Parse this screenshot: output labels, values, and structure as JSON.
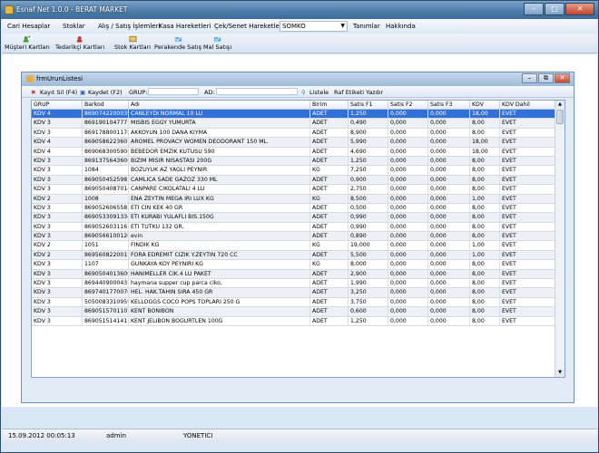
{
  "window": {
    "title": "Esnaf Net 1.0.0 - BERAT MARKET"
  },
  "menu": {
    "items": [
      "Cari Hesaplar",
      "Stoklar",
      "Alış / Satış İşlemleri",
      "Kasa Hareketleri",
      "Çek/Senet Hareketleri"
    ],
    "combo_value": "SOMKO",
    "right_items": [
      "Tanımlar",
      "Hakkında"
    ]
  },
  "toolbar": {
    "buttons": [
      "Müşteri Kartları",
      "Tedarikçi Kartları",
      "Stok Kartları",
      "Perakende Satış",
      "Mal Satışı"
    ]
  },
  "child": {
    "title": "frmUrunListesi",
    "toolbar": {
      "delete": "Kayıt Sil (F4)",
      "save": "Kaydet (F2)",
      "grup_label": "GRUP:",
      "ad_label": "AD:",
      "list": "Listele",
      "print": "Raf Etiketi Yazdır"
    }
  },
  "grid": {
    "headers": [
      "GRUP",
      "Barkod",
      "Adı",
      "Birim",
      "Satis F1",
      "Satis F2",
      "Satis F3",
      "KDV",
      "KDV Dahil"
    ],
    "rows": [
      [
        "KDV 4",
        "8690742200039",
        "CANLEYDI NORMAL 10 LU",
        "ADET",
        "1,250",
        "0,000",
        "0,000",
        "18,00",
        "EVET"
      ],
      [
        "KDV 3",
        "8691901047771",
        "MISBIS EGGY YUMURTA",
        "ADET",
        "0,490",
        "0,000",
        "0,000",
        "8,00",
        "EVET"
      ],
      [
        "KDV 3",
        "8691788001178",
        "AKKOYUN 100 DANA KIYMA",
        "ADET",
        "8,900",
        "0,000",
        "0,000",
        "8,00",
        "EVET"
      ],
      [
        "KDV 4",
        "8690586223607",
        "AROMEL PROVACY WOMEN DEODORANT 150 ML.",
        "ADET",
        "5,990",
        "0,000",
        "0,000",
        "18,00",
        "EVET"
      ],
      [
        "KDV 4",
        "8690683005908",
        "BEBEDOR EMZIK KUTUSU 590",
        "ADET",
        "4,690",
        "0,000",
        "0,000",
        "18,00",
        "EVET"
      ],
      [
        "KDV 3",
        "8691375643606",
        "BIZIM MISIR NISASTASI 200G",
        "ADET",
        "1,250",
        "0,000",
        "0,000",
        "8,00",
        "EVET"
      ],
      [
        "KDV 3",
        "1084",
        "BOZUYUK AZ YAGLI PEYNIR",
        "KG",
        "7,250",
        "0,000",
        "0,000",
        "8,00",
        "EVET"
      ],
      [
        "KDV 3",
        "8690504525981",
        "CAMLICA SADE GAZOZ 330 ML",
        "ADET",
        "0,900",
        "0,000",
        "0,000",
        "8,00",
        "EVET"
      ],
      [
        "KDV 3",
        "8690504087014",
        "CANPARE CIKOLATALI 4 LU",
        "ADET",
        "2,750",
        "0,000",
        "0,000",
        "8,00",
        "EVET"
      ],
      [
        "KDV 2",
        "1008",
        "ENA ZEYTIN MEGA IRI LUX KG",
        "KG",
        "8,500",
        "0,000",
        "0,000",
        "1,00",
        "EVET"
      ],
      [
        "KDV 3",
        "8690526065582",
        "ETI CIN KEK 40 GR",
        "ADET",
        "0,500",
        "0,000",
        "0,000",
        "8,00",
        "EVET"
      ],
      [
        "KDV 3",
        "8690533091334",
        "ETI KURABI  YULAFLI BIS.150G",
        "ADET",
        "0,990",
        "0,000",
        "0,000",
        "8,00",
        "EVET"
      ],
      [
        "KDV 3",
        "8690526031161",
        "ETI TUTKU 132 GR,",
        "ADET",
        "0,990",
        "0,000",
        "0,000",
        "8,00",
        "EVET"
      ],
      [
        "KDV 3",
        "8690566100126",
        "evin",
        "ADET",
        "0,890",
        "0,000",
        "0,000",
        "8,00",
        "EVET"
      ],
      [
        "KDV 2",
        "1051",
        "FINDIK KG",
        "KG",
        "19,000",
        "0,000",
        "0,000",
        "1,00",
        "EVET"
      ],
      [
        "KDV 2",
        "8695608220015",
        "FORA EDREMIT CIZIK Y.ZEYTIN 720 CC",
        "ADET",
        "5,500",
        "0,000",
        "0,000",
        "1,00",
        "EVET"
      ],
      [
        "KDV 3",
        "1107",
        "GUNKAYA KOY PEYNIRI KG",
        "KG",
        "8,000",
        "0,000",
        "0,000",
        "8,00",
        "EVET"
      ],
      [
        "KDV 3",
        "8690504013600",
        "HANIMELLER CIK.4 LU PAKET",
        "ADET",
        "2,900",
        "0,000",
        "0,000",
        "8,00",
        "EVET"
      ],
      [
        "KDV 3",
        "8694409000437",
        "haymana supper cup parca ciko,",
        "ADET",
        "1,990",
        "0,000",
        "0,000",
        "8,00",
        "EVET"
      ],
      [
        "KDV 3",
        "8697401770070",
        "HEL. HAK.TAHIN SIRA 450 GR",
        "ADET",
        "3,250",
        "0,000",
        "0,000",
        "8,00",
        "EVET"
      ],
      [
        "KDV 3",
        "5050083310959",
        "KELLOGGS COCO POPS TOPLARI 250 G",
        "ADET",
        "3,750",
        "0,000",
        "0,000",
        "8,00",
        "EVET"
      ],
      [
        "KDV 3",
        "8690515701107",
        "KENT BONIBON",
        "ADET",
        "0,600",
        "0,000",
        "0,000",
        "8,00",
        "EVET"
      ],
      [
        "KDV 3",
        "8690515141415",
        "KENT JELIBON BOGURTLEN 100G",
        "ADET",
        "1,250",
        "0,000",
        "0,000",
        "8,00",
        "EVET"
      ]
    ]
  },
  "status": {
    "datetime": "15.09.2012 00:05:13",
    "user": "admin",
    "role": "YONETICI"
  }
}
